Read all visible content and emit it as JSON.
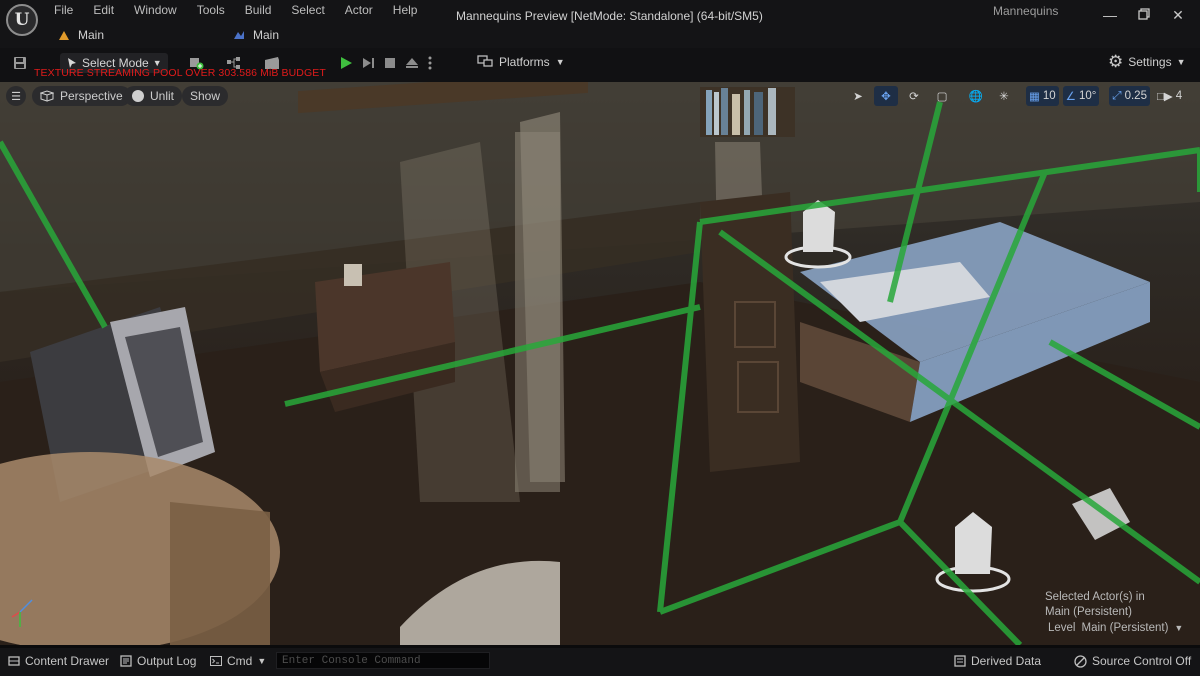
{
  "app": {
    "logo_letter": "U",
    "menu": [
      "File",
      "Edit",
      "Window",
      "Tools",
      "Build",
      "Select",
      "Actor",
      "Help"
    ],
    "window_title": "Mannequins Preview [NetMode: Standalone]  (64-bit/SM5)",
    "project_name": "Mannequins",
    "doc_tabs": [
      {
        "label": "Main",
        "icon": "level-icon"
      },
      {
        "label": "Main",
        "icon": "map-icon"
      }
    ]
  },
  "toolbar": {
    "select_mode": "Select Mode",
    "warning": "TEXTURE STREAMING POOL OVER 303.586 MiB BUDGET",
    "platforms": "Platforms",
    "settings": "Settings"
  },
  "viewport": {
    "perspective": "Perspective",
    "view_mode": "Unlit",
    "show": "Show",
    "grid_snap": "10",
    "rotation_snap": "10°",
    "scale_snap": "0.25",
    "camera_speed": "4",
    "selected_actor": "Selected Actor(s) in",
    "selected_level": "Main (Persistent)",
    "level_label": "Level",
    "level_value": "Main (Persistent)"
  },
  "statusbar": {
    "content_drawer": "Content Drawer",
    "output_log": "Output Log",
    "cmd": "Cmd",
    "console_placeholder": "Enter Console Command",
    "derived_data": "Derived Data",
    "source_control": "Source Control Off"
  },
  "colors": {
    "warning": "#e01b1b",
    "play_green": "#3fbf3f",
    "volume_green": "#28a83a",
    "selection_blue": "#1e2e45"
  }
}
